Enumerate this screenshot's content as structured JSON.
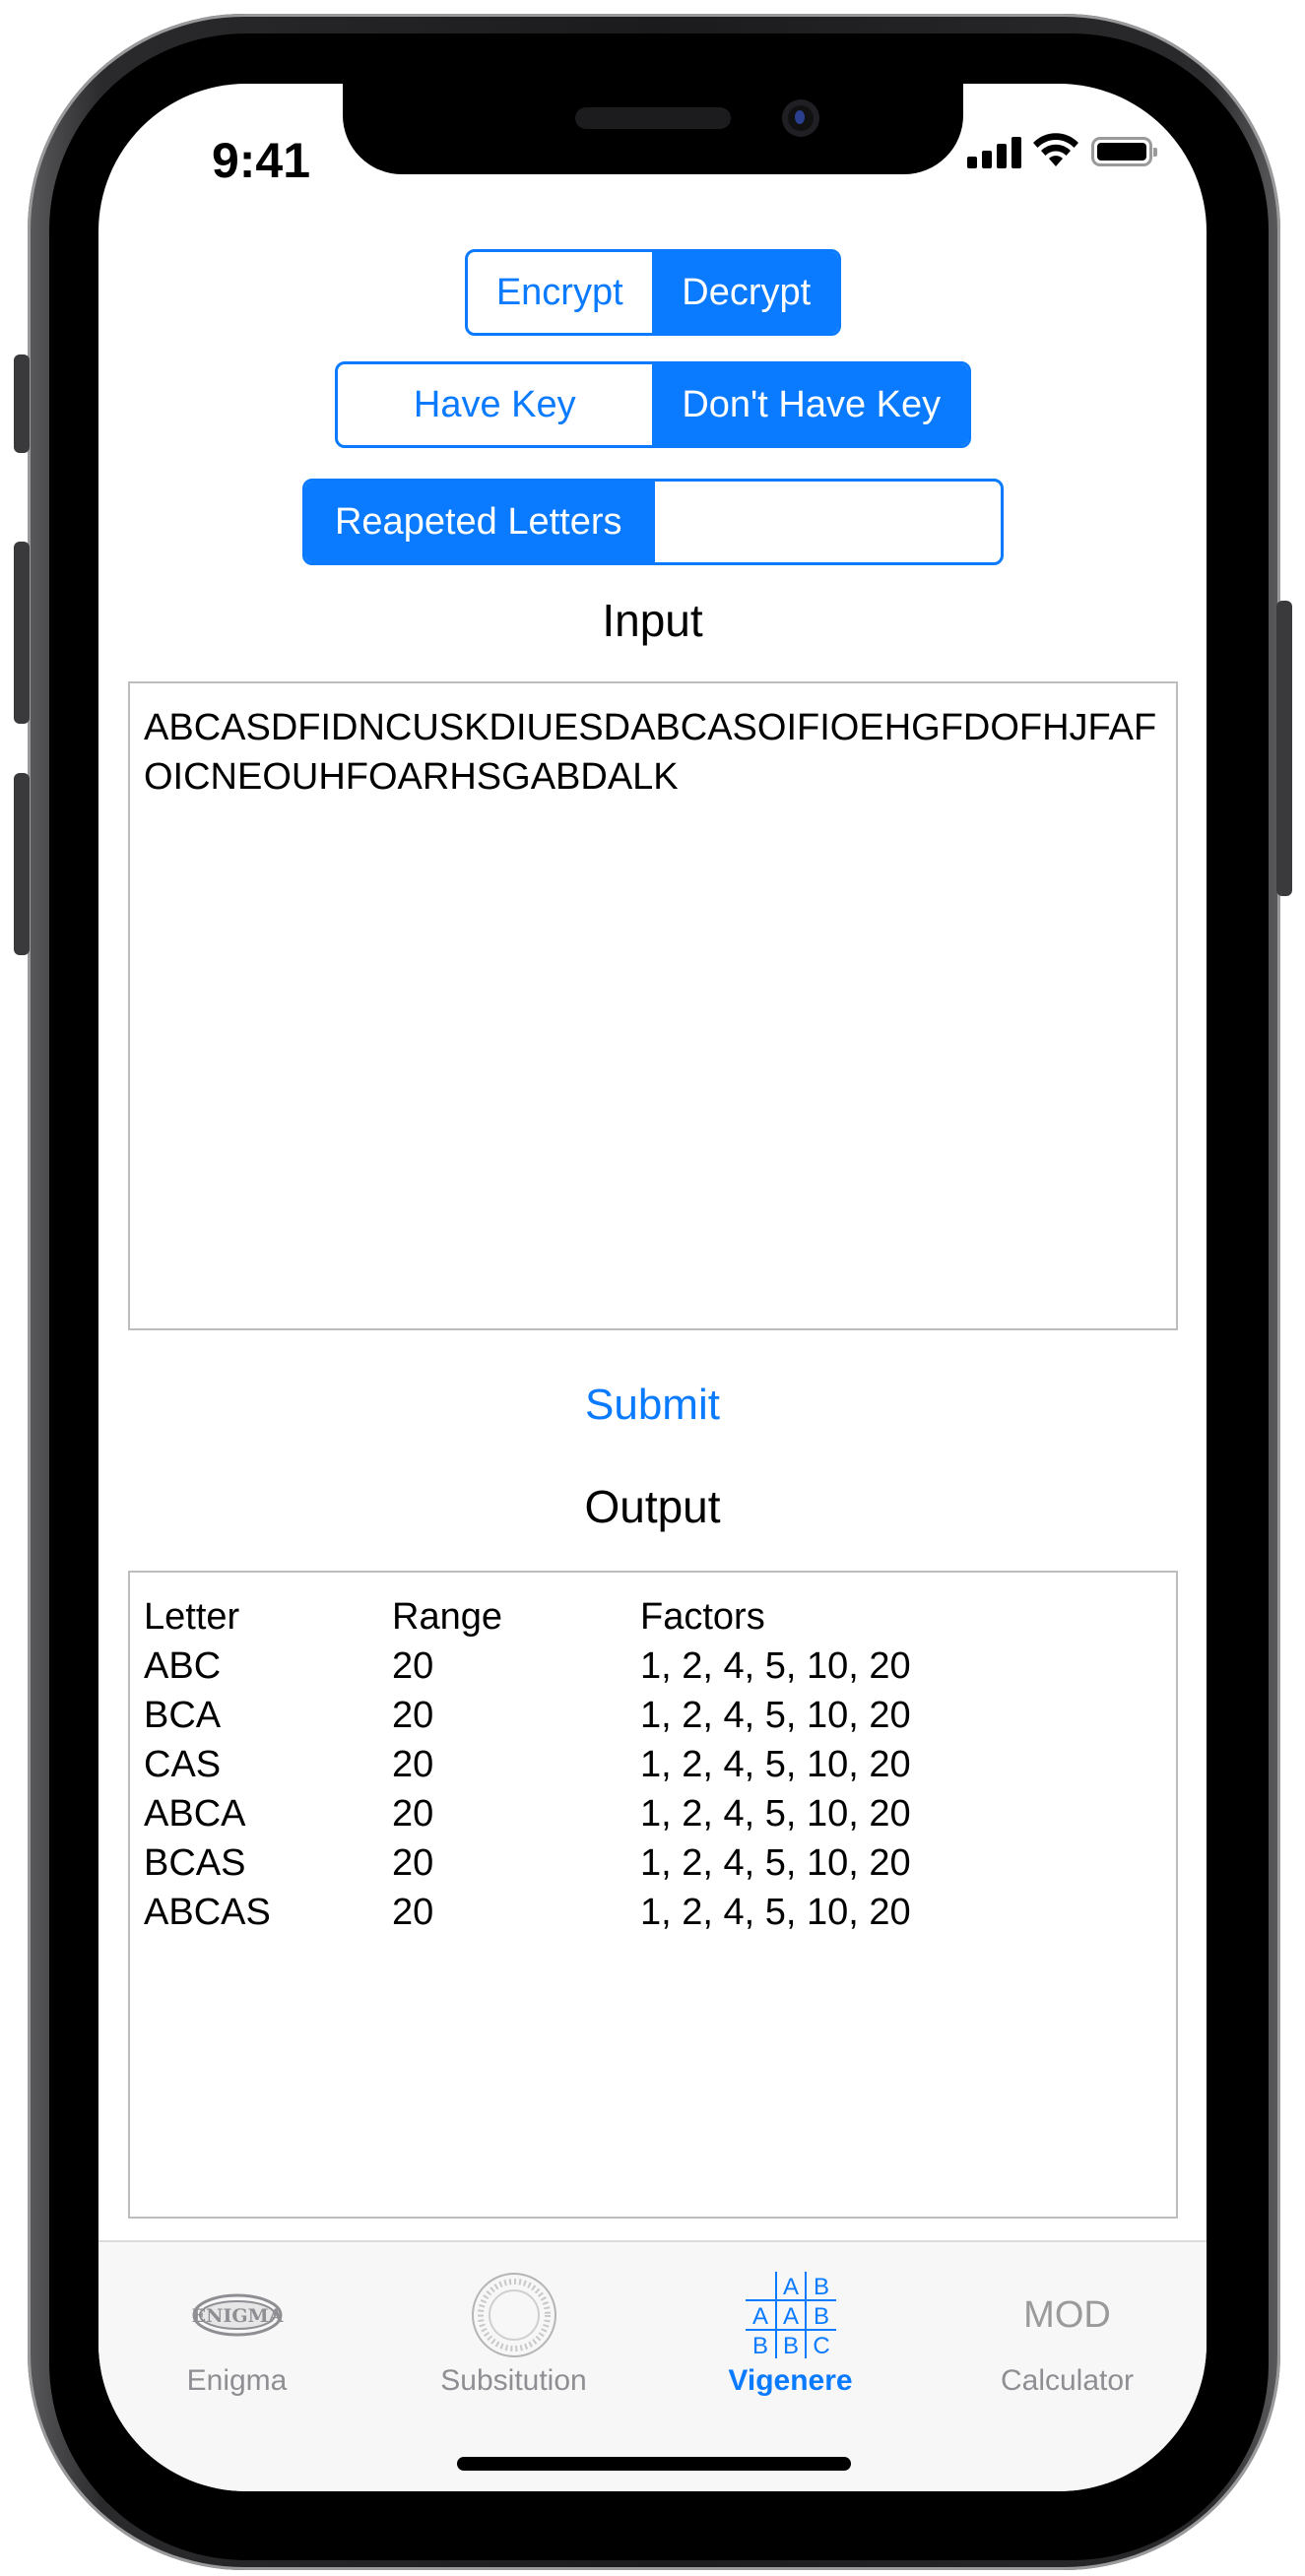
{
  "status_bar": {
    "time": "9:41"
  },
  "mode_control": {
    "segments": [
      "Encrypt",
      "Decrypt"
    ],
    "selected": "Decrypt"
  },
  "key_control": {
    "segments": [
      "Have Key",
      "Don't Have Key"
    ],
    "selected": "Don't Have Key"
  },
  "analysis_control": {
    "segments": [
      "Reapeted Letters",
      ""
    ],
    "selected": "Reapeted Letters"
  },
  "input": {
    "label": "Input",
    "text": "ABCASDFIDNCUSKDIUESDABCASOIFIOEHGFDOFHJFAFOICNEOUHFOARHSGABDALK"
  },
  "submit_label": "Submit",
  "output": {
    "label": "Output",
    "columns": [
      "Letter",
      "Range",
      "Factors"
    ],
    "rows": [
      [
        "ABC",
        "20",
        "1, 2, 4, 5, 10, 20"
      ],
      [
        "BCA",
        "20",
        "1, 2, 4, 5, 10, 20"
      ],
      [
        "CAS",
        "20",
        "1, 2, 4, 5, 10, 20"
      ],
      [
        "ABCA",
        "20",
        "1, 2, 4, 5, 10, 20"
      ],
      [
        "BCAS",
        "20",
        "1, 2, 4, 5, 10, 20"
      ],
      [
        "ABCAS",
        "20",
        "1, 2, 4, 5, 10, 20"
      ]
    ]
  },
  "tabs": [
    {
      "label": "Enigma",
      "icon": "enigma-logo-icon",
      "active": false
    },
    {
      "label": "Subsitution",
      "icon": "cipher-wheel-icon",
      "active": false
    },
    {
      "label": "Vigenere",
      "icon": "vigenere-grid-icon",
      "active": true,
      "grid": [
        "A",
        "B",
        "A",
        "A",
        "B",
        "B",
        "B",
        "C"
      ]
    },
    {
      "label": "Calculator",
      "icon": "mod-icon",
      "active": false,
      "icon_text": "MOD"
    }
  ],
  "colors": {
    "accent": "#0A7AFF",
    "inactive": "#8E8E93"
  }
}
